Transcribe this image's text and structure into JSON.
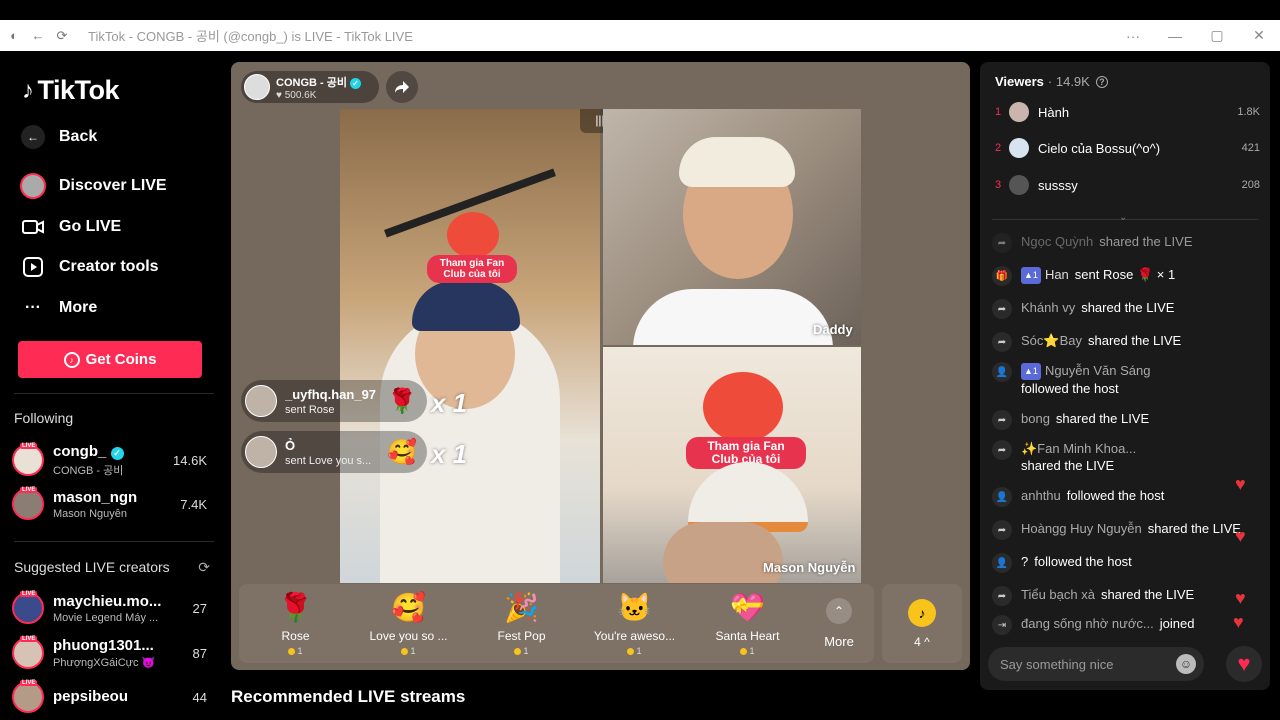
{
  "window": {
    "title": "TikTok - CONGB - 공비 (@congb_) is LIVE - TikTok LIVE"
  },
  "nav": {
    "logo": "TikTok",
    "back": "Back",
    "items": [
      {
        "label": "Discover LIVE",
        "icon": "avatar-icon"
      },
      {
        "label": "Go LIVE",
        "icon": "video-camera-icon"
      },
      {
        "label": "Creator tools",
        "icon": "play-box-icon"
      },
      {
        "label": "More",
        "icon": "more-dots-icon"
      }
    ],
    "get_coins": "Get Coins",
    "following_title": "Following",
    "following": [
      {
        "name": "congb_",
        "sub": "CONGB - 공비",
        "count": "14.6K",
        "verified": true
      },
      {
        "name": "mason_ngn",
        "sub": "Mason Nguyễn",
        "count": "7.4K"
      }
    ],
    "suggested_title": "Suggested LIVE creators",
    "suggested": [
      {
        "name": "maychieu.mo...",
        "sub": "Movie Legend Máy ...",
        "count": "27"
      },
      {
        "name": "phuong1301...",
        "sub": "PhượngXGáiCực 😈",
        "count": "87"
      },
      {
        "name": "pepsibeou",
        "sub": "",
        "count": "44"
      }
    ]
  },
  "stage": {
    "host_name": "CONGB - 공비",
    "host_likes": "♥ 500.6K",
    "video_labels": {
      "top_right": "Daddy",
      "bottom_right": "Mason Nguyễn"
    },
    "fan_club_text": "Tham gia Fan Club của tôi",
    "gift_pops": [
      {
        "user": "_uyfhq.han_97",
        "action": "sent Rose",
        "gift": "🌹",
        "combo": "x 1"
      },
      {
        "user": "Ỏ",
        "action": "sent Love you s...",
        "gift": "🥰",
        "combo": "x 1"
      }
    ],
    "gifts": [
      {
        "name": "Rose",
        "icon": "🌹",
        "price": "1"
      },
      {
        "name": "Love you so ...",
        "icon": "🥰",
        "price": "1"
      },
      {
        "name": "Fest Pop",
        "icon": "🎉",
        "price": "1"
      },
      {
        "name": "You're aweso...",
        "icon": "🐱",
        "price": "1"
      },
      {
        "name": "Santa Heart",
        "icon": "💝",
        "price": "1"
      }
    ],
    "more_label": "More",
    "coin_count": "4 ^",
    "coin_symbol": "♪"
  },
  "recommended_title": "Recommended LIVE streams",
  "viewers": {
    "title": "Viewers",
    "count": "· 14.9K",
    "top": [
      {
        "rank": "1",
        "name": "Hành",
        "score": "1.8K"
      },
      {
        "rank": "2",
        "name": "Cielo của Bossu(^o^)",
        "score": "421"
      },
      {
        "rank": "3",
        "name": "susssy",
        "score": "208"
      }
    ]
  },
  "chat": [
    {
      "icon": "share-icon",
      "user": "Ngọc Quỳnh",
      "text": "shared the LIVE"
    },
    {
      "icon": "gift-icon",
      "level": "1",
      "user": "Han",
      "text": "sent Rose 🌹 × 1",
      "userColor": "#ffffff"
    },
    {
      "icon": "share-icon",
      "user": "Khánh vy",
      "text": "shared the LIVE"
    },
    {
      "icon": "share-icon",
      "user": "Sóc⭐Bay",
      "text": "shared the LIVE"
    },
    {
      "icon": "follow-icon",
      "level": "1",
      "user": "Nguyễn Văn Sáng",
      "text": "followed the host"
    },
    {
      "icon": "share-icon",
      "user": "bong",
      "text": "shared the LIVE"
    },
    {
      "icon": "share-icon",
      "user": "✨Fan Minh Khoa...",
      "text": "shared the LIVE"
    },
    {
      "icon": "follow-icon",
      "user": "anhthu",
      "text": "followed the host"
    },
    {
      "icon": "share-icon",
      "user": "Hoàngg Huy Nguyễn",
      "text": "shared the LIVE"
    },
    {
      "icon": "follow-icon",
      "user": "?",
      "text": "followed the host"
    },
    {
      "icon": "share-icon",
      "user": "Tiểu bạch xà",
      "text": "shared the LIVE"
    },
    {
      "icon": "join-icon",
      "user": "đang sống nhờ nước...",
      "text": "joined"
    }
  ],
  "chat_input_placeholder": "Say something nice",
  "colors": {
    "accent": "#fe2c55",
    "stage": "#75685d",
    "panel": "#1a1a1a"
  }
}
